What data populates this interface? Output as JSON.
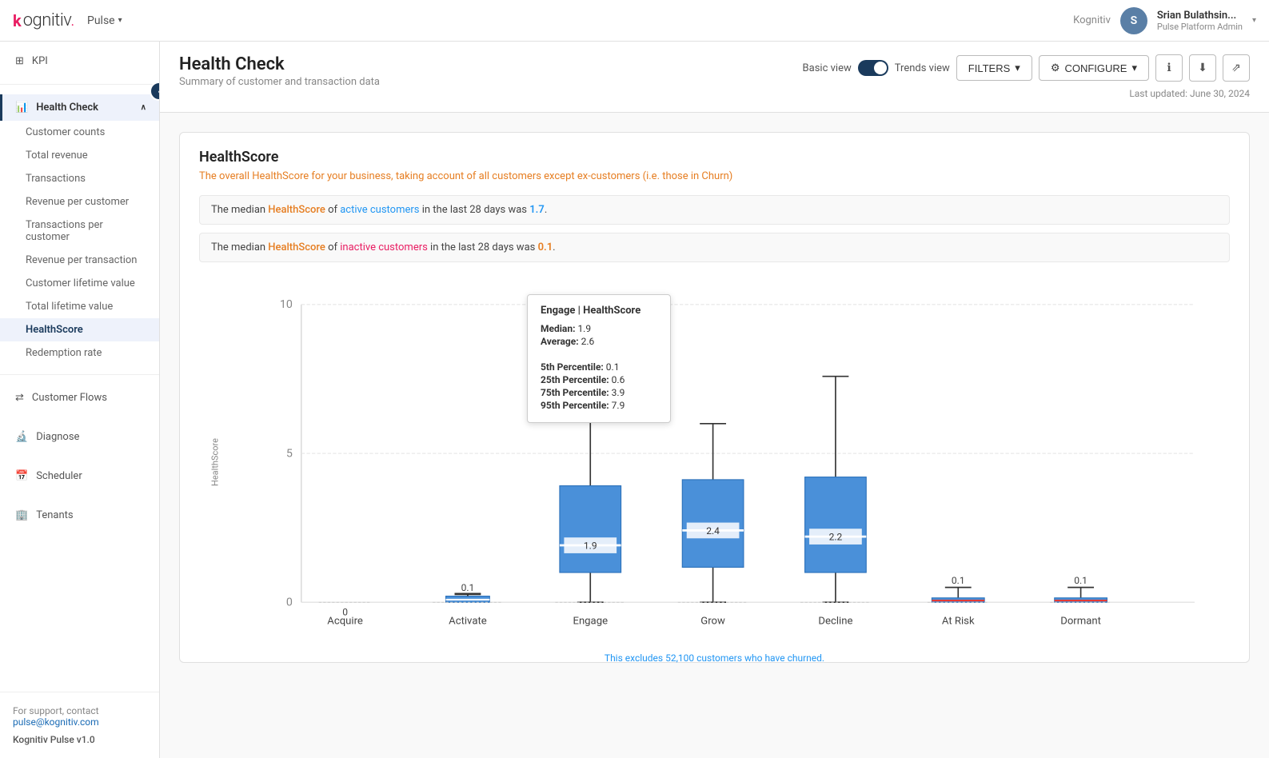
{
  "app": {
    "logo_brand": "kognitiv",
    "logo_accent": ".",
    "product_name": "Pulse",
    "chevron": "▾"
  },
  "nav": {
    "kognitiv_label": "Kognitiv",
    "user_initial": "S",
    "user_name": "Srian Bulathsin...",
    "user_role": "Pulse Platform Admin"
  },
  "sidebar": {
    "toggle_icon": "‹",
    "kpi_label": "KPI",
    "sections": [
      {
        "label": "Health Check",
        "icon": "📊",
        "active": true,
        "expanded": true,
        "sub_items": [
          {
            "label": "Customer counts",
            "active": false
          },
          {
            "label": "Total revenue",
            "active": false
          },
          {
            "label": "Transactions",
            "active": false
          },
          {
            "label": "Revenue per customer",
            "active": false
          },
          {
            "label": "Transactions per customer",
            "active": false
          },
          {
            "label": "Revenue per transaction",
            "active": false
          },
          {
            "label": "Customer lifetime value",
            "active": false
          },
          {
            "label": "Total lifetime value",
            "active": false
          },
          {
            "label": "HealthScore",
            "active": true
          },
          {
            "label": "Redemption rate",
            "active": false
          }
        ]
      },
      {
        "label": "Customer Flows",
        "icon": "🔀",
        "active": false
      },
      {
        "label": "Diagnose",
        "icon": "🔬",
        "active": false
      },
      {
        "label": "Scheduler",
        "icon": "📅",
        "active": false
      },
      {
        "label": "Tenants",
        "icon": "🏢",
        "active": false
      }
    ],
    "footer": {
      "support_text": "For support, contact",
      "support_email": "pulse@kognitiv.com",
      "version": "Kognitiv Pulse v1.0"
    }
  },
  "page": {
    "title": "Health Check",
    "subtitle": "Summary of customer and transaction data",
    "toggle_left": "Basic view",
    "toggle_right": "Trends view",
    "filters_label": "FILTERS",
    "configure_label": "CONFIGURE",
    "last_updated": "Last updated: June 30, 2024"
  },
  "health_score": {
    "title": "HealthScore",
    "description": "The overall HealthScore for your business, taking account of all customers except ex-customers (i.e. those in Churn)",
    "active_info": {
      "prefix": "The median ",
      "hs_link": "HealthScore",
      "of_text": " of ",
      "customer_type": "active customers",
      "suffix": " in the last 28 days was ",
      "value": "1.7",
      "end": "."
    },
    "inactive_info": {
      "prefix": "The median ",
      "hs_link": "HealthScore",
      "of_text": " of ",
      "customer_type": "inactive customers",
      "suffix": " in the last 28 days was ",
      "value": "0.1",
      "end": "."
    },
    "chart": {
      "y_label": "HealthScore",
      "y_max": 10,
      "y_ticks": [
        0,
        5,
        10
      ],
      "categories": [
        "Acquire",
        "Activate",
        "Engage",
        "Grow",
        "Decline",
        "At Risk",
        "Dormant"
      ],
      "boxes": [
        {
          "category": "Acquire",
          "median_label": "0",
          "q1": 0,
          "q3": 0,
          "whisker_low": 0,
          "whisker_high": 0,
          "color": "#4a90d9"
        },
        {
          "category": "Activate",
          "median_label": "0.1",
          "q1": 0,
          "q3": 0.2,
          "whisker_low": 0,
          "whisker_high": 0.5,
          "color": "#4a90d9"
        },
        {
          "category": "Engage",
          "median_label": "1.9",
          "q1": 1.0,
          "q3": 3.9,
          "whisker_low": 0,
          "whisker_high": 7.8,
          "color": "#4a90d9",
          "active": true
        },
        {
          "category": "Grow",
          "median_label": "2.4",
          "q1": 1.2,
          "q3": 4.1,
          "whisker_low": 0,
          "whisker_high": 6.0,
          "color": "#4a90d9"
        },
        {
          "category": "Decline",
          "median_label": "2.2",
          "q1": 1.0,
          "q3": 4.2,
          "whisker_low": 0,
          "whisker_high": 7.6,
          "color": "#4a90d9"
        },
        {
          "category": "At Risk",
          "median_label": "0.1",
          "q1": 0,
          "q3": 0.15,
          "whisker_low": 0,
          "whisker_high": 0.5,
          "color_median": "#e53935",
          "color": "#4a90d9"
        },
        {
          "category": "Dormant",
          "median_label": "0.1",
          "q1": 0,
          "q3": 0.15,
          "whisker_low": 0,
          "whisker_high": 0.5,
          "color_median": "#e53935",
          "color": "#4a90d9"
        }
      ],
      "footer_note": "This excludes 52,100 customers who have churned."
    },
    "tooltip": {
      "title": "Engage | HealthScore",
      "median_label": "Median:",
      "median_value": "1.9",
      "average_label": "Average:",
      "average_value": "2.6",
      "p5_label": "5th Percentile:",
      "p5_value": "0.1",
      "p25_label": "25th Percentile:",
      "p25_value": "0.6",
      "p75_label": "75th Percentile:",
      "p75_value": "3.9",
      "p95_label": "95th Percentile:",
      "p95_value": "7.9"
    }
  }
}
